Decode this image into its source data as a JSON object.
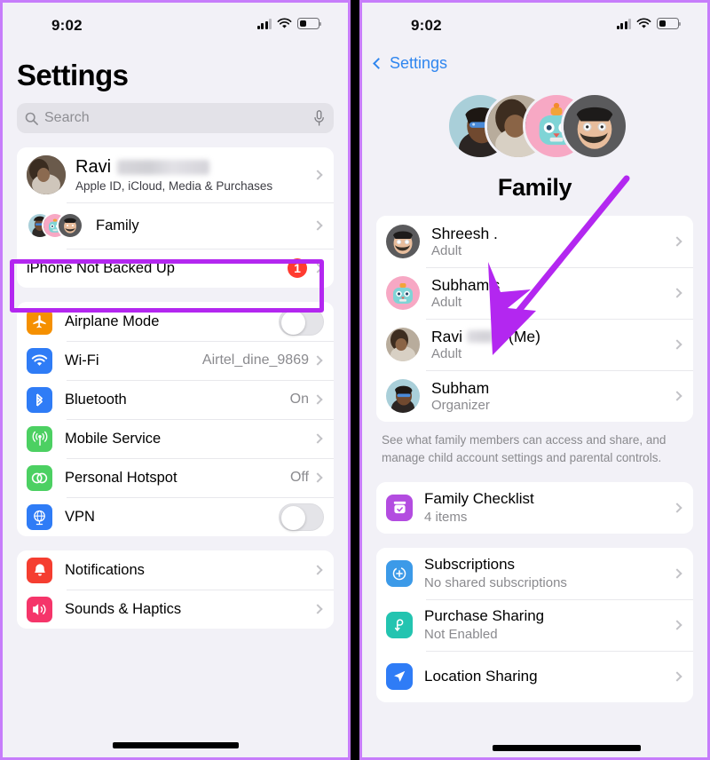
{
  "meta": {
    "accent_purple": "#b327f0",
    "ios_blue": "#2f86ef",
    "badge_red": "#ff3b30"
  },
  "left_phone": {
    "status_bar": {
      "time": "9:02",
      "cellular_icon": "signal-bars-icon",
      "wifi_icon": "wifi-icon",
      "battery_icon": "battery-low-icon"
    },
    "page_title": "Settings",
    "search": {
      "placeholder": "Search",
      "search_icon": "search-icon",
      "dictation_icon": "microphone-icon"
    },
    "account_group": {
      "account": {
        "name": "Ravi",
        "name_redacted": true,
        "subtitle": "Apple ID, iCloud, Media & Purchases"
      },
      "family": {
        "label": "Family",
        "highlighted": true
      },
      "backup": {
        "label": "iPhone Not Backed Up",
        "badge": "1"
      }
    },
    "connectivity_group": [
      {
        "label": "Airplane Mode",
        "icon": "airplane-icon",
        "icon_color": "#f59000",
        "control": "toggle",
        "toggle_on": false
      },
      {
        "label": "Wi-Fi",
        "icon": "wifi-icon",
        "icon_color": "#2f7cf6",
        "control": "value",
        "value": "Airtel_dine_9869"
      },
      {
        "label": "Bluetooth",
        "icon": "bluetooth-icon",
        "icon_color": "#2f7cf6",
        "control": "value",
        "value": "On"
      },
      {
        "label": "Mobile Service",
        "icon": "cellular-antenna-icon",
        "icon_color": "#4cd062",
        "control": "value",
        "value": ""
      },
      {
        "label": "Personal Hotspot",
        "icon": "hotspot-link-icon",
        "icon_color": "#4cd062",
        "control": "value",
        "value": "Off"
      },
      {
        "label": "VPN",
        "icon": "globe-vpn-icon",
        "icon_color": "#2f7cf6",
        "control": "toggle",
        "toggle_on": false
      }
    ],
    "notifications_group": [
      {
        "label": "Notifications",
        "icon": "bell-icon",
        "icon_color": "#f53e30"
      },
      {
        "label": "Sounds & Haptics",
        "icon": "speaker-icon",
        "icon_color": "#f5356a",
        "redacted": true
      }
    ]
  },
  "right_phone": {
    "status_bar": {
      "time": "9:02",
      "cellular_icon": "signal-bars-icon",
      "wifi_icon": "wifi-icon",
      "battery_icon": "battery-low-icon"
    },
    "back_label": "Settings",
    "back_icon": "chevron-left-icon",
    "hero_title": "Family",
    "hero_avatar_count": 4,
    "members": [
      {
        "name": "Shreesh .",
        "role": "Adult",
        "avatar": "memoji-beard-avatar"
      },
      {
        "name": "Subham's",
        "role": "Adult",
        "avatar": "robot-memoji-avatar"
      },
      {
        "name": "Ravi",
        "role": "Adult",
        "avatar": "photo-avatar",
        "name_redacted": true,
        "suffix": "(Me)"
      },
      {
        "name": "Subham",
        "role": "Organizer",
        "avatar": "photo-sunglasses-avatar"
      }
    ],
    "footnote": "See what family members can access and share, and manage child account settings and parental controls.",
    "checklist": {
      "title": "Family Checklist",
      "subtitle": "4 items",
      "icon": "checklist-icon",
      "icon_color": "#b34ce0"
    },
    "sharing_group": [
      {
        "title": "Subscriptions",
        "subtitle": "No shared subscriptions",
        "icon": "subscriptions-icon",
        "icon_color": "#3c9ae8"
      },
      {
        "title": "Purchase Sharing",
        "subtitle": "Not Enabled",
        "icon": "purchase-sharing-icon",
        "icon_color": "#23c4b0"
      },
      {
        "title": "Location Sharing",
        "subtitle": "",
        "icon": "location-arrow-icon",
        "icon_color": "#2f7cf6",
        "redacted": true
      }
    ]
  },
  "annotations": {
    "highlight_box_target": "Family",
    "arrow_target": "Ravi (Me) member row",
    "arrow_color": "#b327f0",
    "box_color": "#b327f0"
  }
}
